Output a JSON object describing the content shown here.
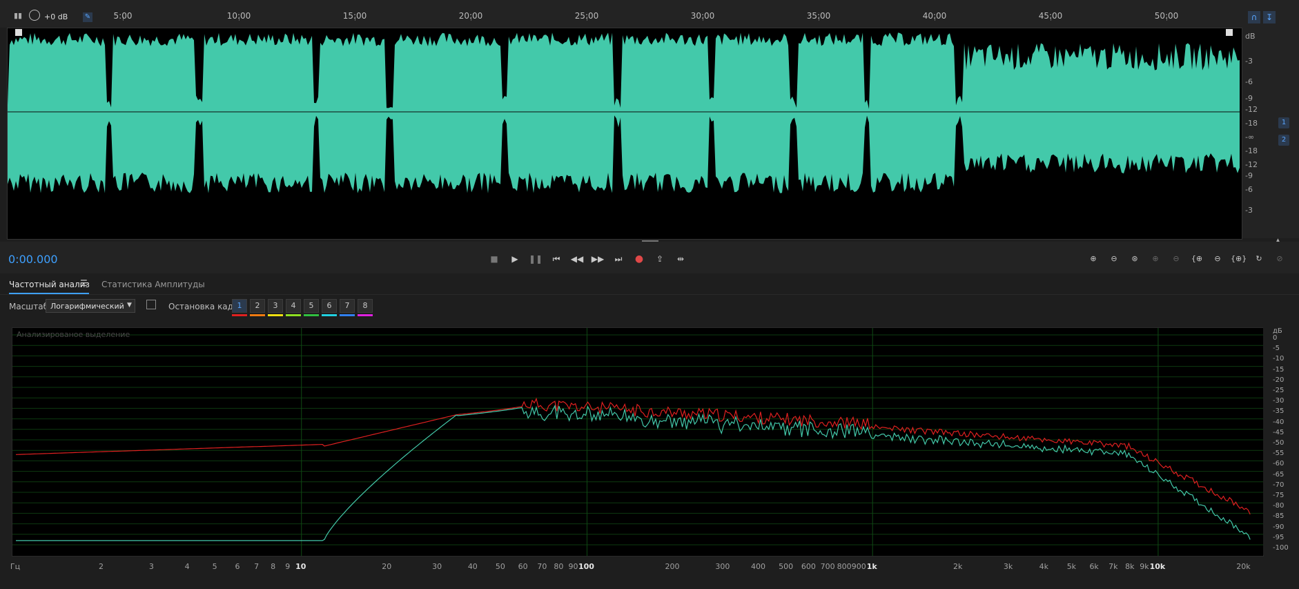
{
  "top": {
    "gain": "+0 dB",
    "time_ticks": [
      "5:00",
      "10:00",
      "15:00",
      "20:00",
      "25:00",
      "30:00",
      "35:00",
      "40:00",
      "45:00",
      "50:00"
    ]
  },
  "waveform": {
    "color": "#43c9aa",
    "db_labels": [
      "dB",
      "-3",
      "-6",
      "-9",
      "-12",
      "-18",
      "-∞",
      "-18",
      "-12",
      "-9",
      "-6",
      "-3"
    ],
    "channels": [
      "1",
      "2"
    ]
  },
  "transport": {
    "timecode": "0:00.000",
    "buttons": [
      "stop",
      "play",
      "pause",
      "go-to-start",
      "rewind",
      "fast-forward",
      "go-to-end",
      "record",
      "export",
      "skip-selection"
    ]
  },
  "panel": {
    "tab_freq": "Частотный анализ",
    "tab_amp": "Статистика Амплитуды",
    "scale_label": "Масштаб:",
    "scale_value": "Логарифмический",
    "freeze_label": "Остановка кадра:",
    "frame_buttons": [
      "1",
      "2",
      "3",
      "4",
      "5",
      "6",
      "7",
      "8"
    ],
    "frame_colors": [
      "#e02020",
      "#f07a10",
      "#f0e010",
      "#8ee020",
      "#30c040",
      "#20d0e0",
      "#3080f0",
      "#e020e0"
    ],
    "hint": "Анализированое выделение"
  },
  "spectrum": {
    "db_labels": [
      "дБ",
      "0",
      "-5",
      "-10",
      "-15",
      "-20",
      "-25",
      "-30",
      "-35",
      "-40",
      "-45",
      "-50",
      "-55",
      "-60",
      "-65",
      "-70",
      "-75",
      "-80",
      "-85",
      "-90",
      "-95",
      "-100"
    ],
    "freq_labels": [
      "Гц",
      "2",
      "3",
      "4",
      "5",
      "6",
      "7",
      "8",
      "9",
      "10",
      "20",
      "30",
      "40",
      "50",
      "60",
      "70",
      "80",
      "90",
      "100",
      "200",
      "300",
      "400",
      "500",
      "600",
      "700",
      "800",
      "900",
      "1k",
      "2k",
      "3k",
      "4k",
      "5k",
      "6k",
      "7k",
      "8k",
      "9k",
      "10k",
      "20k"
    ],
    "series_colors": [
      "#e02020",
      "#43c9aa"
    ]
  }
}
